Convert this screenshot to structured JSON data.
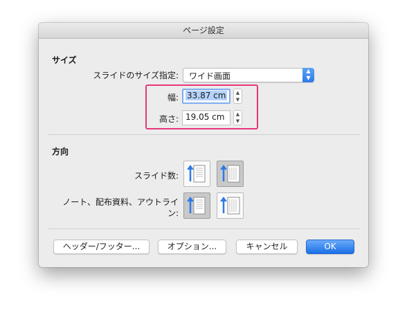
{
  "dialog": {
    "title": "ページ設定"
  },
  "size_section": {
    "heading": "サイズ",
    "slide_size_label": "スライドのサイズ指定:",
    "slide_size_value": "ワイド画面",
    "width_label": "幅:",
    "width_value": "33.87 cm",
    "height_label": "高さ:",
    "height_value": "19.05 cm"
  },
  "orientation_section": {
    "heading": "方向",
    "slides_label": "スライド数:",
    "notes_label_line1": "ノート、配布資料、アウトライ",
    "notes_label_line2": "ン:"
  },
  "buttons": {
    "header_footer": "ヘッダー/フッター...",
    "options": "オプション...",
    "cancel": "キャンセル",
    "ok": "OK"
  },
  "colors": {
    "accent": "#2d7ae8",
    "highlight_annotation": "#e8357a",
    "dialog_background": "#ececec"
  }
}
